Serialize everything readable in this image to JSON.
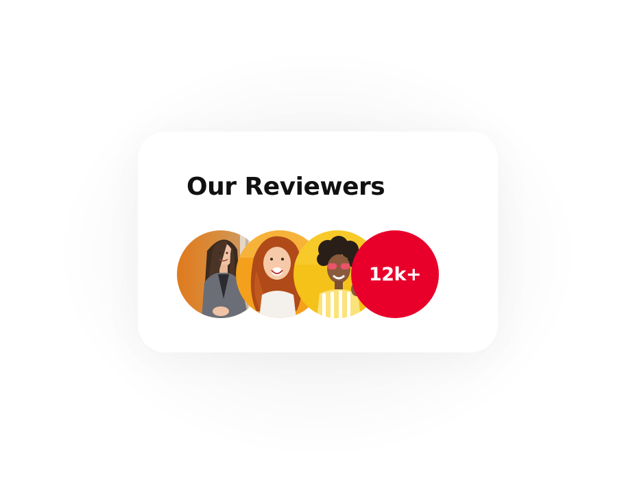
{
  "reviewers_card": {
    "title": "Our Reviewers",
    "count_label": "12k+",
    "avatars": [
      {
        "name": "reviewer-avatar-1",
        "kind": "photo"
      },
      {
        "name": "reviewer-avatar-2",
        "kind": "photo"
      },
      {
        "name": "reviewer-avatar-3",
        "kind": "photo"
      }
    ]
  },
  "colors": {
    "count_bg": "#e8002b",
    "count_text": "#ffffff",
    "title_text": "#111111",
    "card_bg": "#ffffff"
  }
}
